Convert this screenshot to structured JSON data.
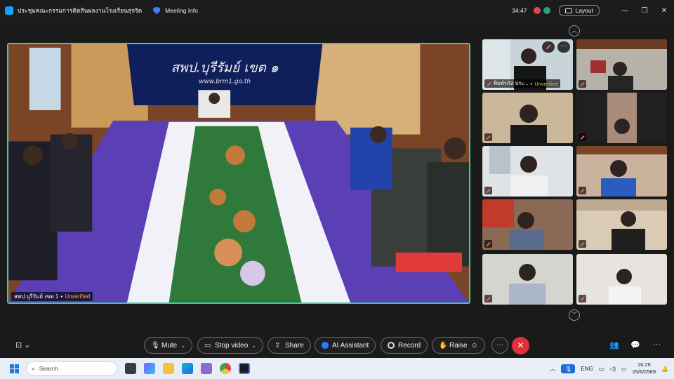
{
  "titlebar": {
    "meeting_title": "ประชุมคณะกรรมการติดสินผลงานโรงเรียนสุจริต",
    "meeting_info": "Meeting Info",
    "timer": "34:47",
    "layout_label": "Layout",
    "minimize": "—",
    "maximize": "❐",
    "close": "✕"
  },
  "main_video": {
    "banner_line1": "สพป.บุรีรัมย์ เขต ๑",
    "banner_line2": "www.brm1.go.th",
    "name": "สพป.บุรีรัมย์ เขต 1",
    "status": "Unverified"
  },
  "gallery": {
    "first_tile_name": "พิมพ์รภัส ประ...",
    "first_tile_status": "Unverified",
    "menu_glyph": "···"
  },
  "controls": {
    "mute": "Mute",
    "stop_video": "Stop video",
    "share": "Share",
    "ai_assistant": "AI Assistant",
    "record": "Record",
    "raise": "Raise",
    "more": "···",
    "end": "✕"
  },
  "taskbar": {
    "search_placeholder": "Search",
    "lang": "ENG",
    "time": "16:29",
    "date": "25/6/2569"
  },
  "colors": {
    "active_speaker_border": "#3ec9a7",
    "unverified": "#f3b12a",
    "end_call": "#e0303a",
    "muted": "#ff5a5a"
  }
}
